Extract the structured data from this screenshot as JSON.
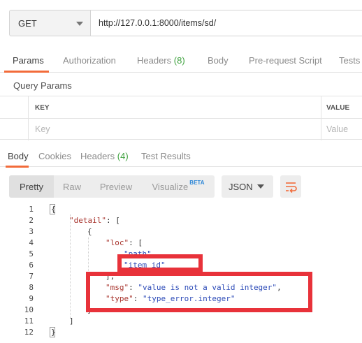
{
  "request": {
    "method": "GET",
    "url": "http://127.0.0.1:8000/items/sd/"
  },
  "request_tabs": [
    {
      "label": "Params",
      "count": ""
    },
    {
      "label": "Authorization",
      "count": ""
    },
    {
      "label": "Headers",
      "count": "(8)"
    },
    {
      "label": "Body",
      "count": ""
    },
    {
      "label": "Pre-request Script",
      "count": ""
    },
    {
      "label": "Tests",
      "count": ""
    }
  ],
  "query_params": {
    "title": "Query Params",
    "key_header": "KEY",
    "value_header": "VALUE",
    "key_placeholder": "Key",
    "value_placeholder": "Value"
  },
  "response_tabs": [
    {
      "label": "Body",
      "count": ""
    },
    {
      "label": "Cookies",
      "count": ""
    },
    {
      "label": "Headers",
      "count": "(4)"
    },
    {
      "label": "Test Results",
      "count": ""
    }
  ],
  "view_modes": [
    "Pretty",
    "Raw",
    "Preview",
    "Visualize"
  ],
  "beta_badge": "BETA",
  "format": "JSON",
  "code_lines": [
    {
      "n": "1",
      "indent": 0,
      "parts": [
        {
          "t": "p",
          "v": "{"
        }
      ]
    },
    {
      "n": "2",
      "indent": 1,
      "parts": [
        {
          "t": "k",
          "v": "\"detail\""
        },
        {
          "t": "p",
          "v": ": ["
        }
      ]
    },
    {
      "n": "3",
      "indent": 2,
      "parts": [
        {
          "t": "p",
          "v": "{"
        }
      ]
    },
    {
      "n": "4",
      "indent": 3,
      "parts": [
        {
          "t": "k",
          "v": "\"loc\""
        },
        {
          "t": "p",
          "v": ": ["
        }
      ]
    },
    {
      "n": "5",
      "indent": 4,
      "parts": [
        {
          "t": "s",
          "v": "\"path\","
        }
      ]
    },
    {
      "n": "6",
      "indent": 4,
      "parts": [
        {
          "t": "s",
          "v": "\"item_id\""
        }
      ]
    },
    {
      "n": "7",
      "indent": 3,
      "parts": [
        {
          "t": "p",
          "v": "],"
        }
      ]
    },
    {
      "n": "8",
      "indent": 3,
      "parts": [
        {
          "t": "k",
          "v": "\"msg\""
        },
        {
          "t": "p",
          "v": ": "
        },
        {
          "t": "s",
          "v": "\"value is not a valid integer\""
        },
        {
          "t": "p",
          "v": ","
        }
      ]
    },
    {
      "n": "9",
      "indent": 3,
      "parts": [
        {
          "t": "k",
          "v": "\"type\""
        },
        {
          "t": "p",
          "v": ": "
        },
        {
          "t": "s",
          "v": "\"type_error.integer\""
        }
      ]
    },
    {
      "n": "10",
      "indent": 2,
      "parts": [
        {
          "t": "p",
          "v": "}"
        }
      ]
    },
    {
      "n": "11",
      "indent": 1,
      "parts": [
        {
          "t": "p",
          "v": "]"
        }
      ]
    },
    {
      "n": "12",
      "indent": 0,
      "parts": [
        {
          "t": "p",
          "v": "}"
        }
      ]
    }
  ],
  "colors": {
    "accent": "#f26b3a",
    "count_green": "#3fa23f",
    "json_key": "#a8342d",
    "json_string": "#2e4cb8",
    "annotation_red": "#e8323a"
  },
  "icons": {
    "method_dropdown": "chevron-down-icon",
    "format_dropdown": "chevron-down-icon",
    "wrap": "wrap-lines-icon"
  }
}
